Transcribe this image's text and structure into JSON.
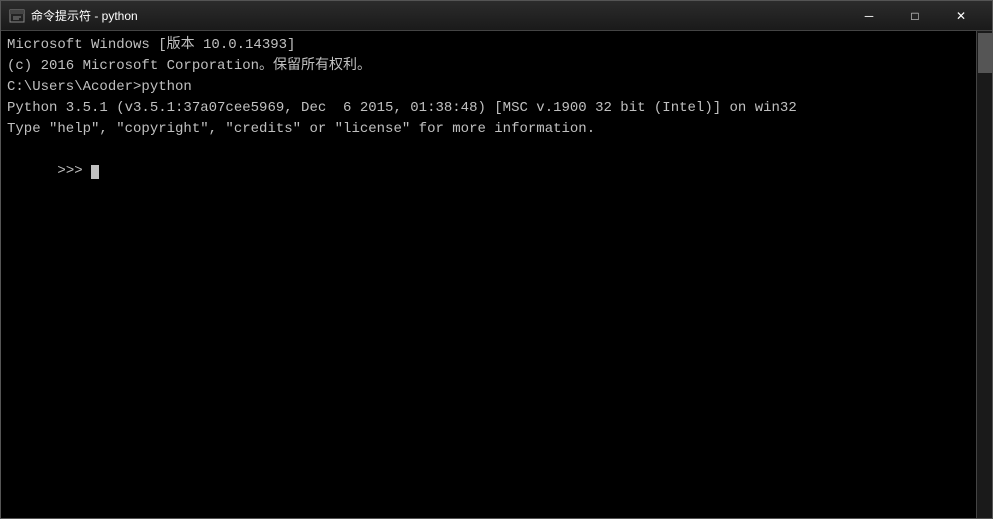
{
  "window": {
    "title": "命令提示符 - python",
    "icon": "⊞"
  },
  "titlebar": {
    "minimize_label": "─",
    "maximize_label": "□",
    "close_label": "✕"
  },
  "console": {
    "lines": [
      "Microsoft Windows [版本 10.0.14393]",
      "(c) 2016 Microsoft Corporation。保留所有权利。",
      "",
      "C:\\Users\\Acoder>python",
      "Python 3.5.1 (v3.5.1:37a07cee5969, Dec  6 2015, 01:38:48) [MSC v.1900 32 bit (Intel)] on win32",
      "Type \"help\", \"copyright\", \"credits\" or \"license\" for more information.",
      ">>> "
    ]
  }
}
